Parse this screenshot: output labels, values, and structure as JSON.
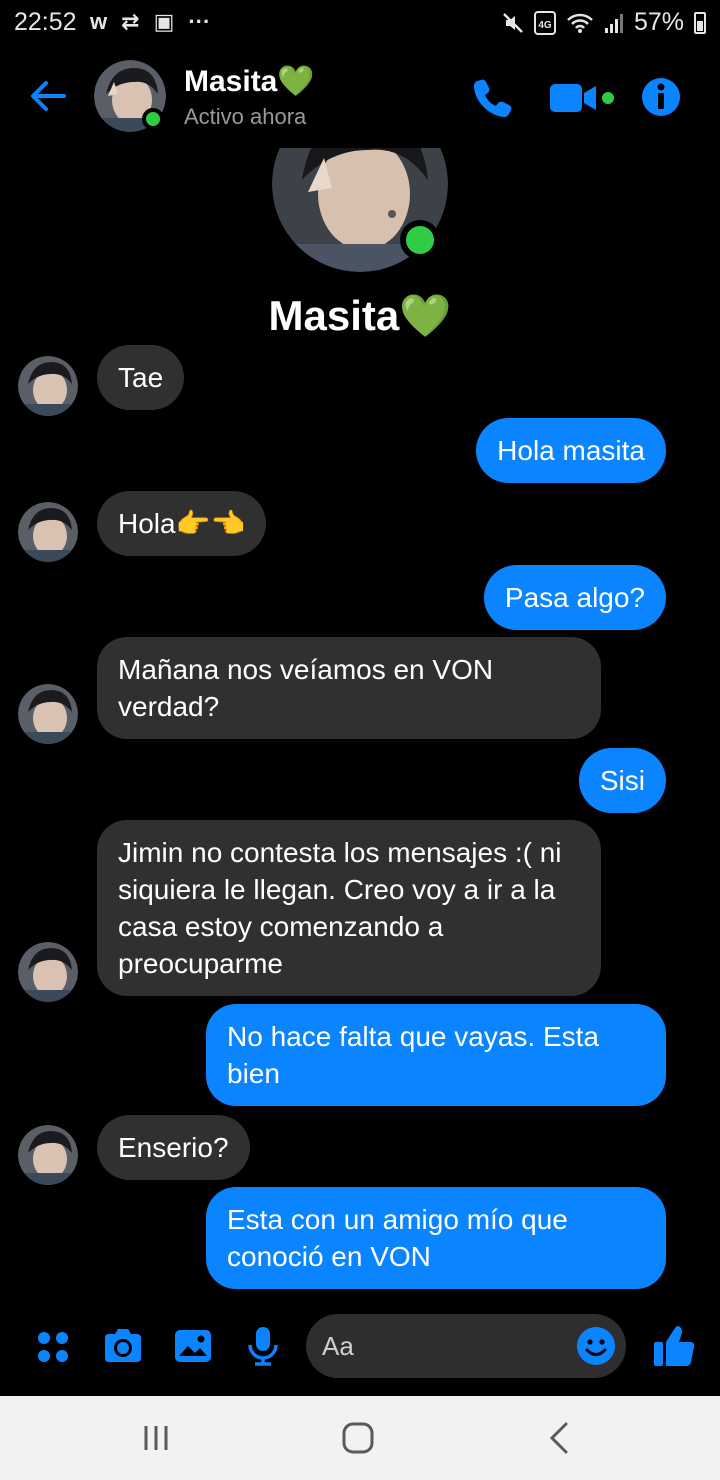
{
  "status_bar": {
    "time": "22:52",
    "left_icons": [
      "w-icon",
      "retweet-icon",
      "image-icon",
      "more-icon"
    ],
    "left_text": [
      "w",
      "⇄",
      "▣",
      "···"
    ],
    "battery": "57%"
  },
  "header": {
    "name": "Masita💚",
    "status": "Activo ahora"
  },
  "profile": {
    "name": "Masita💚"
  },
  "messages": [
    {
      "dir": "in",
      "text": "Tae"
    },
    {
      "dir": "out",
      "text": "Hola masita"
    },
    {
      "dir": "in",
      "text": "Hola👉👈"
    },
    {
      "dir": "out",
      "text": "Pasa algo?"
    },
    {
      "dir": "in",
      "text": "Mañana nos veíamos en VON verdad?"
    },
    {
      "dir": "out",
      "text": "Sisi"
    },
    {
      "dir": "in",
      "text": "Jimin no contesta los mensajes :( ni siquiera le llegan. Creo voy a ir a la casa estoy comenzando a preocuparme"
    },
    {
      "dir": "out",
      "text": "No hace falta que vayas. Esta bien"
    },
    {
      "dir": "in",
      "text": "Enserio?"
    },
    {
      "dir": "out",
      "text": "Esta con un amigo mío que conoció en VON"
    }
  ],
  "composer": {
    "placeholder": "Aa"
  },
  "colors": {
    "accent": "#0a84ff",
    "incoming_bubble": "#303030",
    "online": "#31cc46",
    "background": "#000000"
  }
}
